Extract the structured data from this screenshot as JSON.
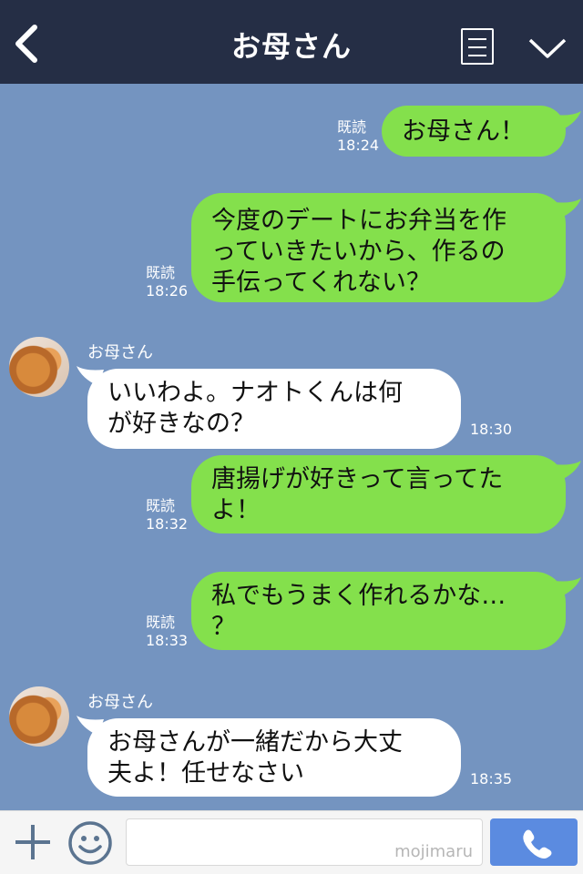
{
  "header": {
    "title": "お母さん",
    "back_icon": "chevron-left-icon",
    "menu_icon": "list-icon",
    "collapse_icon": "chevron-down-icon"
  },
  "messages": [
    {
      "direction": "out",
      "text": "お母さん！",
      "read": "既読",
      "time": "18:24"
    },
    {
      "direction": "out",
      "text_lines": [
        "今度のデートにお弁当を作",
        "っていきたいから、作るの",
        "手伝ってくれない？"
      ],
      "read": "既読",
      "time": "18:26"
    },
    {
      "direction": "in",
      "sender": "お母さん",
      "text_lines": [
        "いいわよ。ナオトくんは何",
        "が好きなの？"
      ],
      "time": "18:30"
    },
    {
      "direction": "out",
      "text_lines": [
        "唐揚げが好きって言ってた",
        "よ！"
      ],
      "read": "既読",
      "time": "18:32"
    },
    {
      "direction": "out",
      "text_lines": [
        "私でもうまく作れるかな…",
        "？"
      ],
      "read": "既読",
      "time": "18:33"
    },
    {
      "direction": "in",
      "sender": "お母さん",
      "text_lines": [
        "お母さんが一緒だから大丈",
        "夫よ！任せなさい"
      ],
      "time": "18:35"
    }
  ],
  "footer": {
    "watermark": "mojimaru",
    "plus_icon": "plus-icon",
    "emoji_icon": "smiley-icon",
    "call_icon": "phone-icon"
  },
  "colors": {
    "header_bg": "#252e45",
    "chat_bg": "#7494c0",
    "outgoing_bubble": "#84e04c",
    "incoming_bubble": "#ffffff",
    "call_button": "#5b8be0"
  }
}
